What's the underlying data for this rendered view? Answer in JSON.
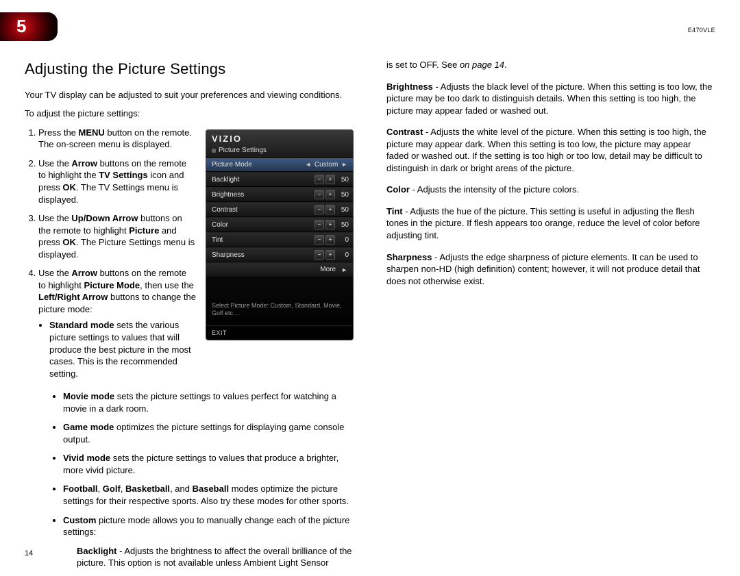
{
  "chapter_number": "5",
  "model": "E470VLE",
  "page_number": "14",
  "section_title": "Adjusting the Picture Settings",
  "intro1": "Your TV display can be adjusted to suit your preferences and viewing conditions.",
  "intro2": "To adjust the picture settings:",
  "steps": {
    "s1a": "Press the ",
    "s1b": "MENU",
    "s1c": " button on the remote. The on-screen menu is displayed.",
    "s2a": "Use the ",
    "s2b": "Arrow",
    "s2c": " buttons on the remote to highlight the ",
    "s2d": "TV Settings",
    "s2e": " icon and press ",
    "s2f": "OK",
    "s2g": ". The TV Settings menu is displayed.",
    "s3a": "Use the ",
    "s3b": "Up/Down Arrow",
    "s3c": " buttons on the remote to highlight ",
    "s3d": "Picture",
    "s3e": " and press ",
    "s3f": "OK",
    "s3g": ". The Picture Settings menu is displayed.",
    "s4a": "Use the ",
    "s4b": "Arrow",
    "s4c": " buttons on the remote to highlight ",
    "s4d": "Picture Mode",
    "s4e": ", then use the ",
    "s4f": "Left/Right Arrow",
    "s4g": " buttons to change the picture mode:"
  },
  "modes": {
    "standard_b": "Standard mode",
    "standard_t": " sets the various picture settings to values that will produce the best picture in the most cases. This is the recommended setting.",
    "movie_b": "Movie mode",
    "movie_t": " sets the picture settings to values perfect for watching a movie in a dark room.",
    "game_b": "Game mode",
    "game_t": " optimizes the picture settings for displaying game console output.",
    "vivid_b": "Vivid mode",
    "vivid_t": " sets the picture settings to values that produce a brighter, more vivid picture.",
    "sports_b1": "Football",
    "sports_sep1": ", ",
    "sports_b2": "Golf",
    "sports_sep2": ", ",
    "sports_b3": "Basketball",
    "sports_sep3": ", and ",
    "sports_b4": "Baseball",
    "sports_t": " modes optimize the picture settings for their respective sports. Also try these modes for other sports.",
    "custom_b": "Custom",
    "custom_t": " picture mode allows you to manually change each of the picture settings:",
    "backlight_b": "Backlight",
    "backlight_t": " - Adjusts the brightness to affect the overall brilliance of the picture. This option is not available unless Ambient Light Sensor"
  },
  "glossary": {
    "off_a": "is set to OFF. See ",
    "off_i": "on page 14",
    "off_c": ".",
    "brightness_b": "Brightness",
    "brightness_t": " - Adjusts the black level of the picture. When this setting is too low, the picture may be too dark to distinguish details. When this setting is too high, the picture may appear faded or washed out.",
    "contrast_b": "Contrast",
    "contrast_t": " - Adjusts the white level of the picture. When this setting is too high, the picture may appear dark. When this setting is too low, the picture may appear faded or washed out. If the setting is too high or too low, detail may be difficult to distinguish in dark or bright areas of the picture.",
    "color_b": "Color",
    "color_t": " - Adjusts the intensity of the picture colors.",
    "tint_b": "Tint",
    "tint_t": " - Adjusts the hue of the picture. This setting is useful in adjusting the flesh tones in the picture. If flesh appears too orange, reduce the level of color before adjusting tint.",
    "sharp_b": "Sharpness",
    "sharp_t": " - Adjusts the edge sharpness of picture elements. It can be used to sharpen non-HD (high definition) content; however, it will not produce detail that does not otherwise exist."
  },
  "tv": {
    "logo": "VIZIO",
    "header_sub": "Picture Settings",
    "row_pm_label": "Picture Mode",
    "row_pm_value": "Custom",
    "row_backlight": "Backlight",
    "val_backlight": "50",
    "row_brightness": "Brightness",
    "val_brightness": "50",
    "row_contrast": "Contrast",
    "val_contrast": "50",
    "row_color": "Color",
    "val_color": "50",
    "row_tint": "Tint",
    "val_tint": "0",
    "row_sharp": "Sharpness",
    "val_sharp": "0",
    "row_more": "More",
    "minus": "−",
    "plus": "+",
    "tri_l": "◄",
    "tri_r": "►",
    "hint": "Select Picture Mode: Custom, Standard, Movie, Golf etc…",
    "exit": "EXIT"
  }
}
